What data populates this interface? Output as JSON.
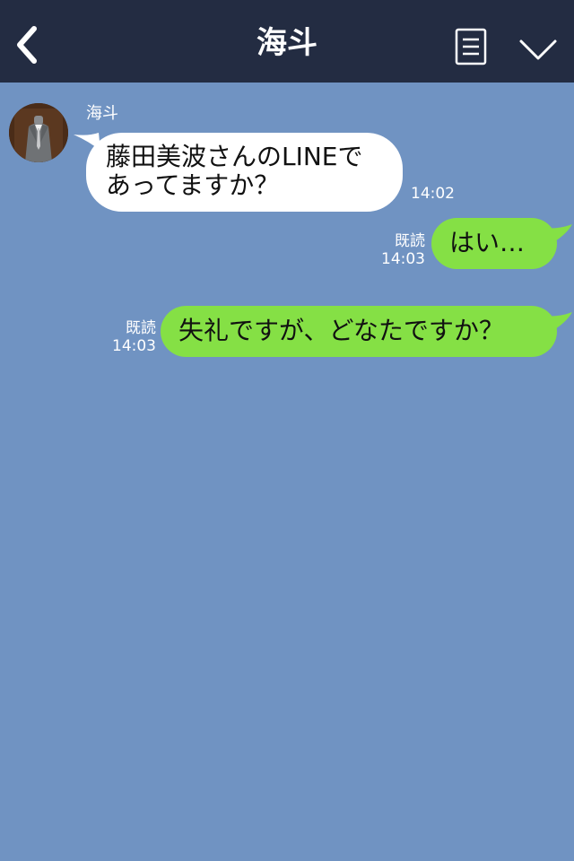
{
  "header": {
    "title": "海斗"
  },
  "chat": {
    "sender_name": "海斗",
    "messages": [
      {
        "direction": "incoming",
        "text_line1": "藤田美波さんのLINEで",
        "text_line2": "あってますか？",
        "time": "14:02"
      },
      {
        "direction": "outgoing",
        "text": "はい…",
        "read_label": "既読",
        "time": "14:03"
      },
      {
        "direction": "outgoing",
        "text": "失礼ですが、どなたですか？",
        "read_label": "既読",
        "time": "14:03"
      }
    ]
  },
  "colors": {
    "header_bg": "#232c42",
    "chat_bg": "#7093c2",
    "incoming_bubble": "#ffffff",
    "outgoing_bubble": "#85e045"
  },
  "icons": {
    "back": "chevron-left-icon",
    "menu": "list-icon",
    "collapse": "chevron-down-icon"
  }
}
